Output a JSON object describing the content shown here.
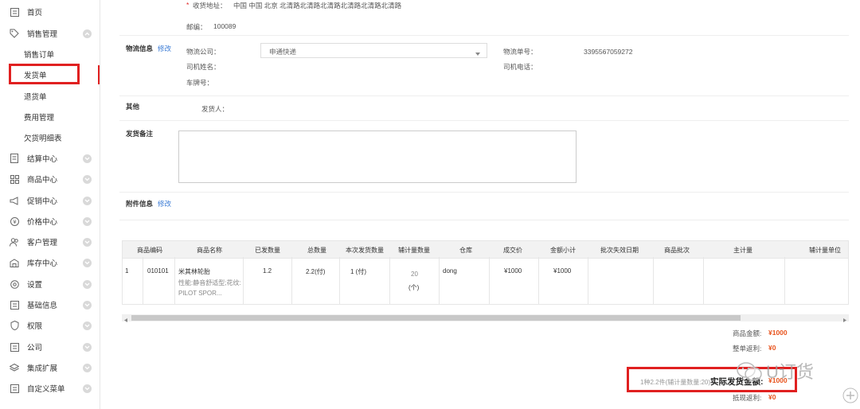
{
  "sidebar": {
    "items": [
      {
        "label": "首页",
        "icon": "list-icon"
      },
      {
        "label": "销售管理",
        "icon": "tag-icon"
      },
      {
        "label": "销售订单"
      },
      {
        "label": "发货单"
      },
      {
        "label": "退货单"
      },
      {
        "label": "费用管理"
      },
      {
        "label": "欠货明细表"
      },
      {
        "label": "结算中心",
        "icon": "document-icon"
      },
      {
        "label": "商品中心",
        "icon": "grid-icon"
      },
      {
        "label": "促销中心",
        "icon": "megaphone-icon"
      },
      {
        "label": "价格中心",
        "icon": "currency-icon"
      },
      {
        "label": "客户管理",
        "icon": "users-icon"
      },
      {
        "label": "库存中心",
        "icon": "warehouse-icon"
      },
      {
        "label": "设置",
        "icon": "gear-icon"
      },
      {
        "label": "基础信息",
        "icon": "list-icon"
      },
      {
        "label": "权限",
        "icon": "shield-icon"
      },
      {
        "label": "公司",
        "icon": "list-icon"
      },
      {
        "label": "集成扩展",
        "icon": "layers-icon"
      },
      {
        "label": "自定义菜单",
        "icon": "list-icon"
      }
    ]
  },
  "address": {
    "asterisk": "*",
    "label": "收货地址：",
    "value": "中国 中国 北京 北清路北清路北清路北清路北清路北清路",
    "zip_label": "邮编：",
    "zip_value": "100089"
  },
  "logistics": {
    "section": "物流信息",
    "edit": "修改",
    "company_label": "物流公司：",
    "company_value": "申通快递",
    "tracking_label": "物流单号：",
    "tracking_value": "3395567059272",
    "driver_label": "司机姓名：",
    "driver_phone_label": "司机电话：",
    "plate_label": "车牌号："
  },
  "other": {
    "section": "其他",
    "shipper_label": "发货人："
  },
  "remark": {
    "section": "发货备注"
  },
  "attachment": {
    "section": "附件信息",
    "edit": "修改"
  },
  "table": {
    "headers": [
      "商品编码",
      "商品名称",
      "已发数量",
      "总数量",
      "本次发货数量",
      "辅计量数量",
      "仓库",
      "成交价",
      "金额小计",
      "批次失效日期",
      "商品批次",
      "主计量",
      "辅计量单位"
    ],
    "row": {
      "index": "1",
      "code": "010101",
      "name": "米其林轮胎",
      "desc1": "性能:静音舒适型;花纹:",
      "desc2": "PILOT SPOR...",
      "shipped": "1.2",
      "total": "2.2(付)",
      "current": "1 (付)",
      "aux_qty": "20",
      "aux_unit": "(个)",
      "warehouse": "dong",
      "price": "¥1000",
      "subtotal": "¥1000"
    }
  },
  "summary": {
    "goods_label": "商品金额:",
    "goods_value": "¥1000",
    "rebate_label": "整单返利:",
    "rebate_value": "¥0",
    "count_text": "1种2.2件(辅计量数量:20)",
    "actual_label": "实际发货金额:",
    "actual_value": "¥1000",
    "offset_label": "抵现返利:",
    "offset_value": "¥0"
  },
  "watermark": "U订货",
  "colors": {
    "accent": "#3a7bd5",
    "highlight": "#e02020",
    "amount": "#e8541e"
  }
}
